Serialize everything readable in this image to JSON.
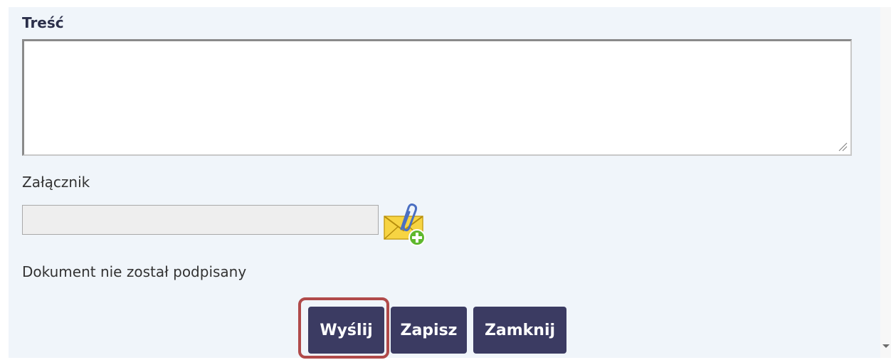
{
  "form": {
    "content_label": "Treść",
    "content_value": "",
    "attachment_label": "Załącznik",
    "attachment_value": "",
    "signature_status": "Dokument nie został podpisany"
  },
  "actions": {
    "send_label": "Wyślij",
    "save_label": "Zapisz",
    "close_label": "Zamknij"
  },
  "icons": {
    "attach": "attach-envelope-icon"
  },
  "colors": {
    "button_bg": "#3b3b62",
    "highlight": "#b04a4a",
    "panel_bg": "#f0f5fa"
  }
}
